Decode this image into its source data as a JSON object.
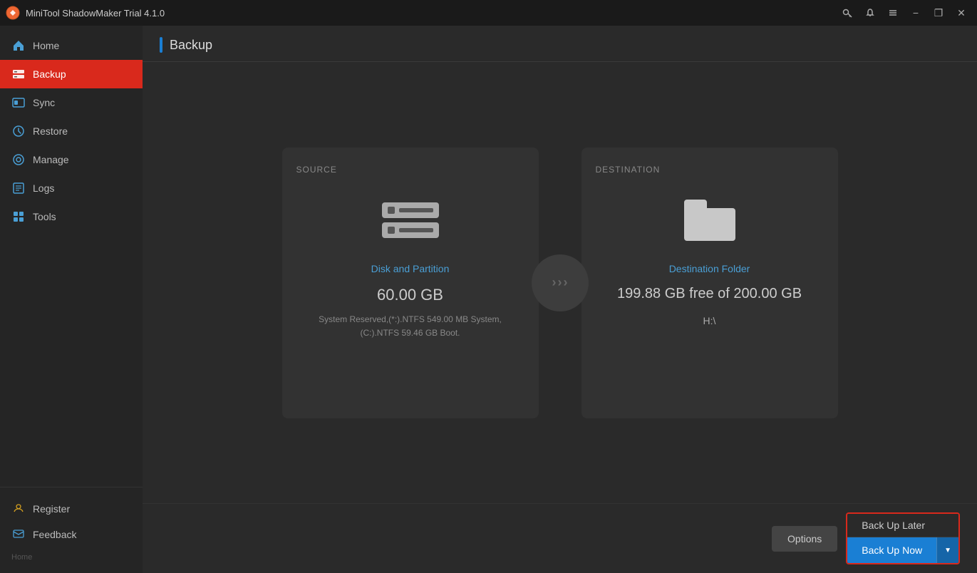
{
  "app": {
    "title": "MiniTool ShadowMaker Trial 4.1.0"
  },
  "titlebar": {
    "title": "MiniTool ShadowMaker Trial 4.1.0",
    "controls": {
      "minimize": "−",
      "maximize": "❐",
      "close": "✕"
    }
  },
  "sidebar": {
    "items": [
      {
        "id": "home",
        "label": "Home",
        "active": false
      },
      {
        "id": "backup",
        "label": "Backup",
        "active": true
      },
      {
        "id": "sync",
        "label": "Sync",
        "active": false
      },
      {
        "id": "restore",
        "label": "Restore",
        "active": false
      },
      {
        "id": "manage",
        "label": "Manage",
        "active": false
      },
      {
        "id": "logs",
        "label": "Logs",
        "active": false
      },
      {
        "id": "tools",
        "label": "Tools",
        "active": false
      }
    ],
    "bottom": [
      {
        "id": "register",
        "label": "Register"
      },
      {
        "id": "feedback",
        "label": "Feedback"
      }
    ],
    "app_name": "Home"
  },
  "page": {
    "title": "Backup"
  },
  "source": {
    "label": "SOURCE",
    "type_label": "Disk and Partition",
    "size": "60.00 GB",
    "details_line1": "System Reserved,(*:).NTFS 549.00 MB System,",
    "details_line2": "(C:).NTFS 59.46 GB Boot."
  },
  "destination": {
    "label": "DESTINATION",
    "type_label": "Destination Folder",
    "size": "199.88 GB free of 200.00 GB",
    "path": "H:\\"
  },
  "buttons": {
    "options": "Options",
    "back_up_later": "Back Up Later",
    "back_up_now": "Back Up Now",
    "dropdown_arrow": "▼"
  },
  "bottom": {
    "app_name": "Home"
  }
}
